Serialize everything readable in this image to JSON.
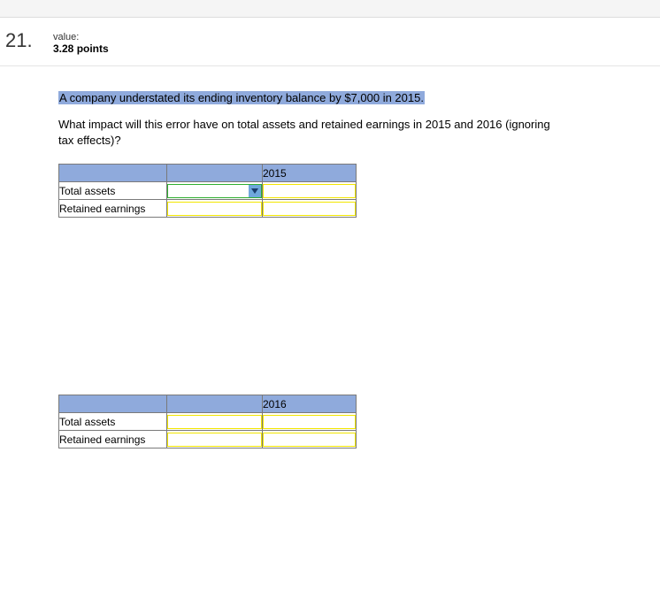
{
  "question": {
    "number": "21.",
    "value_label": "value:",
    "points": "3.28 points",
    "highlighted_text": "A company understated its ending inventory balance by $7,000 in 2015.",
    "prompt": "What impact will this error have on total assets and retained earnings in 2015 and 2016 (ignoring tax effects)?"
  },
  "tables": [
    {
      "year": "2015",
      "rows": [
        {
          "label": "Total assets",
          "has_dropdown": true
        },
        {
          "label": "Retained earnings",
          "has_dropdown": false
        }
      ]
    },
    {
      "year": "2016",
      "rows": [
        {
          "label": "Total assets",
          "has_dropdown": false
        },
        {
          "label": "Retained earnings",
          "has_dropdown": false
        }
      ]
    }
  ]
}
